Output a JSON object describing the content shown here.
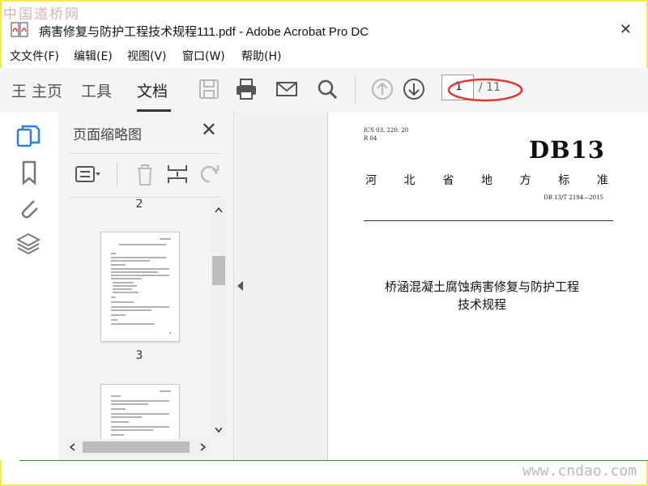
{
  "watermark": {
    "top": "中国道桥网",
    "bottom": "www.cndao.com"
  },
  "window": {
    "title": "病害修复与防护工程技术规程111.pdf - Adobe Acrobat Pro DC",
    "close": "✕"
  },
  "menu": [
    "文文件(F)",
    "编辑(E)",
    "视图(V)",
    "窗口(W)",
    "帮助(H)"
  ],
  "toolbar": {
    "tabs": [
      {
        "label": "王 主页"
      },
      {
        "label": "工具"
      },
      {
        "label": "文档"
      }
    ],
    "current_page": "1",
    "total_pages": "/ 11"
  },
  "panel": {
    "title": "页面缩略图",
    "close": "✕",
    "page_labels": [
      "2",
      "3"
    ]
  },
  "document": {
    "ics": "ICS 03. 220. 20",
    "r": "R 04",
    "code": "DB13",
    "standard_chars": [
      "河",
      "北",
      "省",
      "地",
      "方",
      "标",
      "准"
    ],
    "std_no": "DB 13/T 2194—2015",
    "title_line1": "桥涵混凝土腐蚀病害修复与防护工程",
    "title_line2": "技术规程"
  },
  "colors": {
    "accent_red": "#e23a32",
    "frame": "#f3e74b",
    "watermark": "#d9b3b3"
  }
}
